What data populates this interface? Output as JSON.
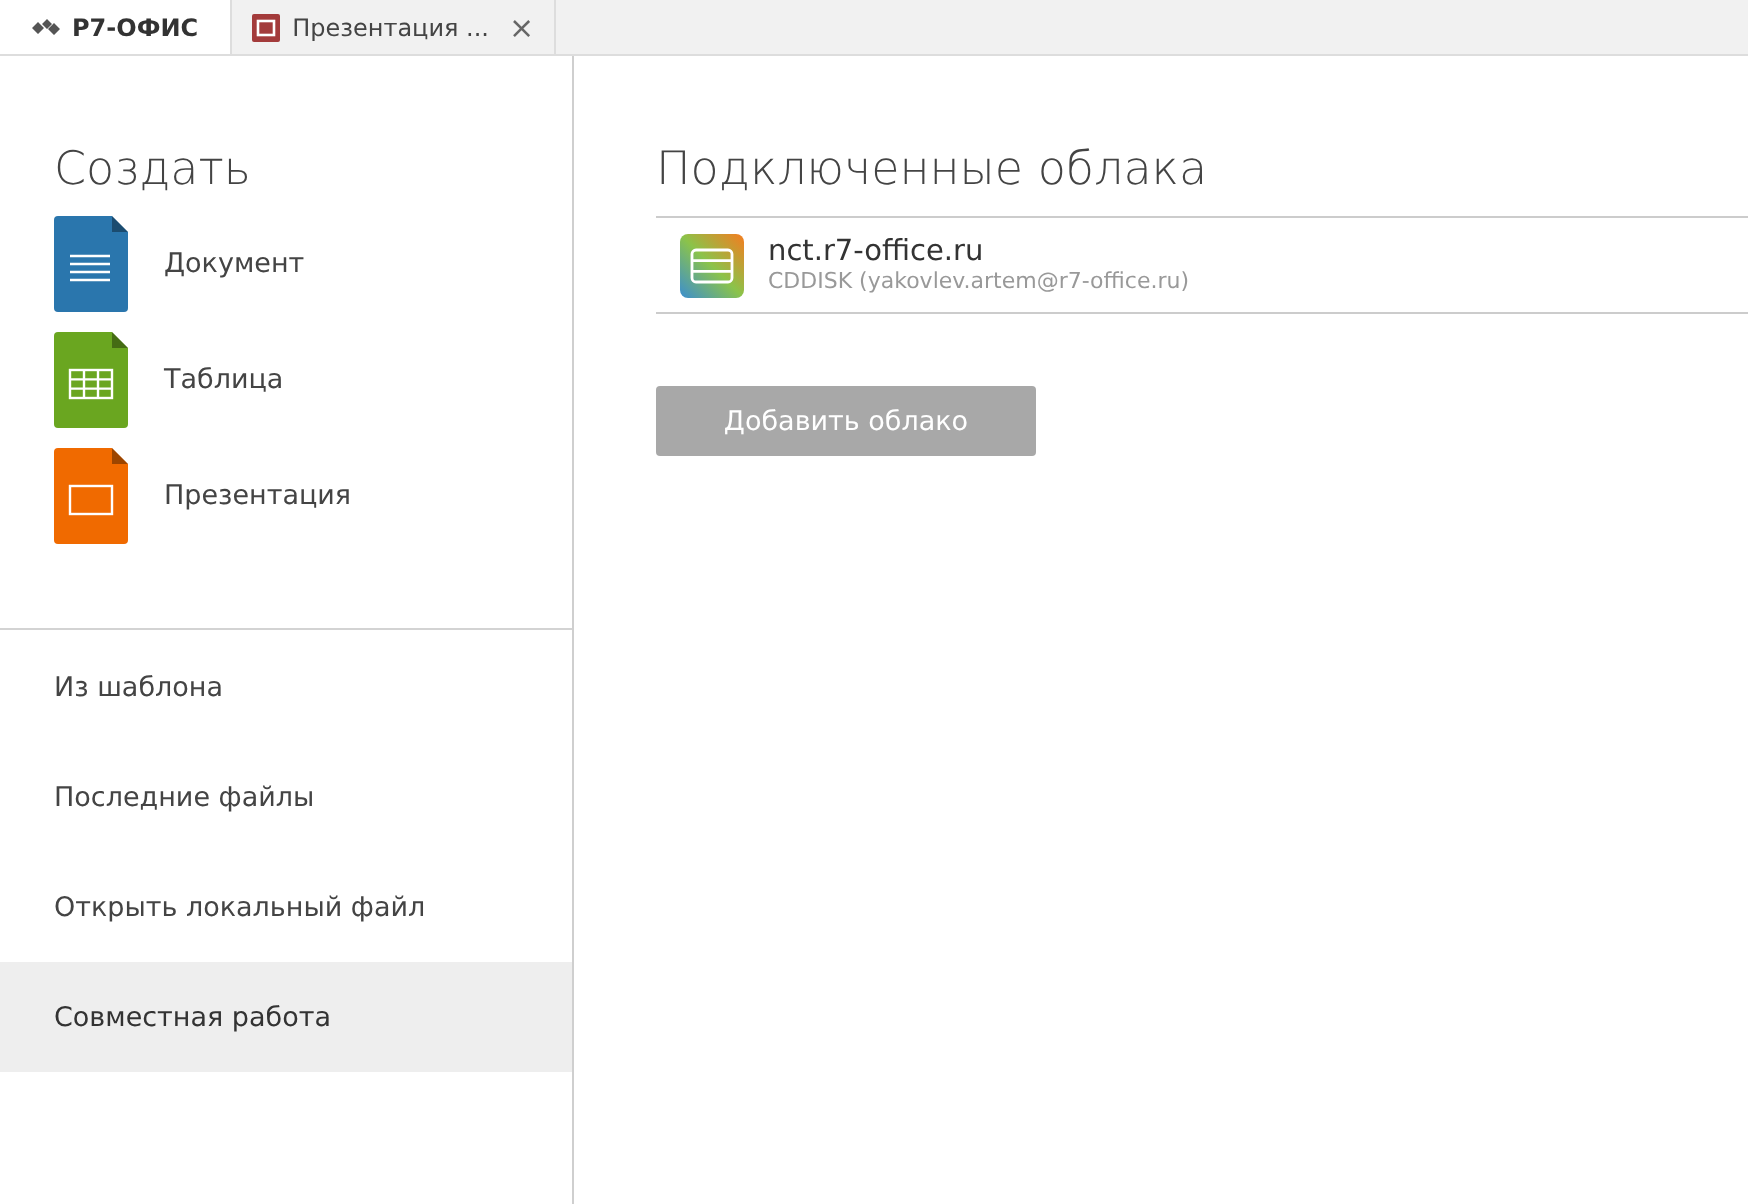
{
  "tabs": [
    {
      "kind": "home",
      "label": "Р7-ОФИС",
      "selected": true
    },
    {
      "kind": "presentation",
      "label": "Презентация ...",
      "close": "×",
      "selected": false
    }
  ],
  "sidebar": {
    "title": "Создать",
    "create_items": [
      {
        "kind": "document",
        "label": "Документ"
      },
      {
        "kind": "spreadsheet",
        "label": "Таблица"
      },
      {
        "kind": "presentation",
        "label": "Презентация"
      }
    ],
    "menu_items": [
      {
        "label": "Из шаблона",
        "selected": false
      },
      {
        "label": "Последние файлы",
        "selected": false
      },
      {
        "label": "Открыть локальный файл",
        "selected": false
      },
      {
        "label": "Совместная работа",
        "selected": true
      }
    ]
  },
  "main": {
    "title": "Подключенные облака",
    "clouds": [
      {
        "name": "nct.r7-office.ru",
        "account": "CDDISK (yakovlev.artem@r7-office.ru)"
      }
    ],
    "add_button": "Добавить облако"
  }
}
